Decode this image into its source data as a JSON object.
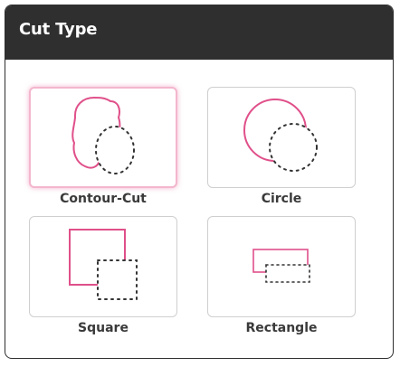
{
  "panel": {
    "title": "Cut Type"
  },
  "options": [
    {
      "label": "Contour-Cut",
      "icon": "contour-cut-icon",
      "selected": true
    },
    {
      "label": "Circle",
      "icon": "circle-cut-icon",
      "selected": false
    },
    {
      "label": "Square",
      "icon": "square-cut-icon",
      "selected": false
    },
    {
      "label": "Rectangle",
      "icon": "rectangle-cut-icon",
      "selected": false
    }
  ],
  "colors": {
    "header_bg": "#2f2f2f",
    "accent_pink": "#e0508a",
    "selected_glow": "#f3b6cd",
    "card_border": "#cfcfcf",
    "dotted": "#333333"
  }
}
